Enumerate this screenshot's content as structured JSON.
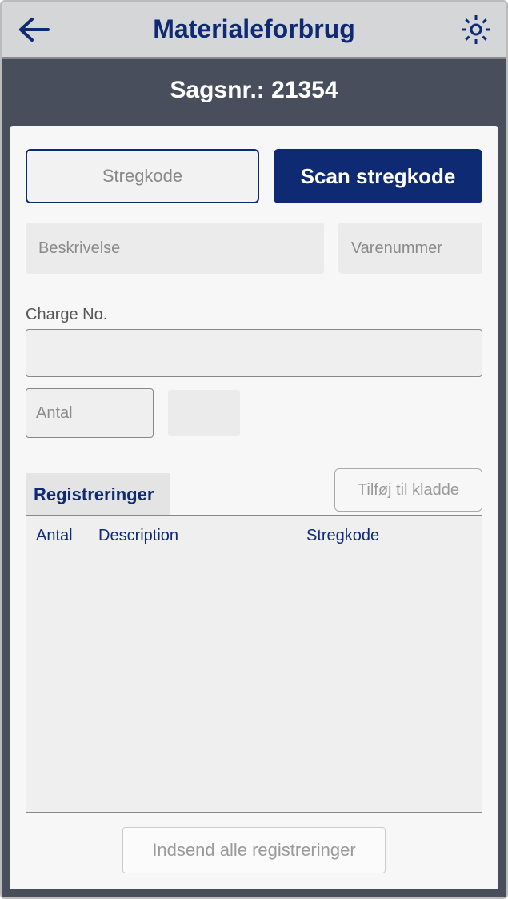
{
  "header": {
    "title": "Materialeforbrug"
  },
  "case": {
    "label": "Sagsnr.: 21354"
  },
  "inputs": {
    "barcode_placeholder": "Stregkode",
    "scan_button": "Scan stregkode",
    "description_placeholder": "Beskrivelse",
    "itemno_placeholder": "Varenummer",
    "charge_label": "Charge No.",
    "quantity_placeholder": "Antal"
  },
  "actions": {
    "add_to_draft": "Tilføj til kladde",
    "submit_all": "Indsend alle registreringer"
  },
  "tab": {
    "label": "Registreringer"
  },
  "grid": {
    "columns": {
      "qty": "Antal",
      "description": "Description",
      "barcode": "Stregkode"
    }
  }
}
